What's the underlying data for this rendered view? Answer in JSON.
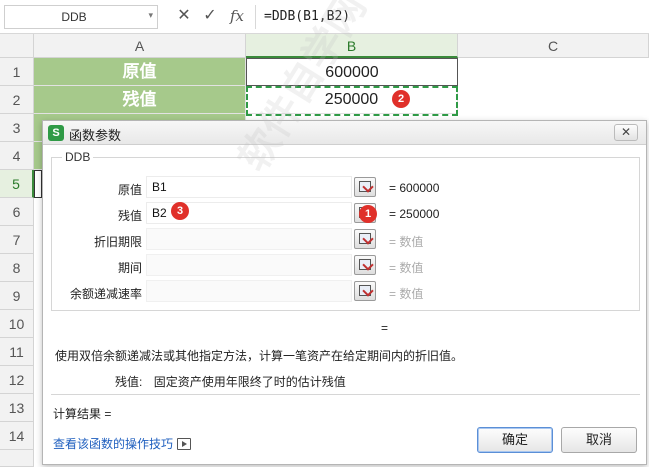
{
  "formula_bar": {
    "name_box": "DDB",
    "cancel_glyph": "✕",
    "enter_glyph": "✓",
    "fx_label": "fx",
    "formula": "=DDB(B1,B2)"
  },
  "sheet": {
    "columns": [
      "A",
      "B",
      "C"
    ],
    "rows": [
      "1",
      "2",
      "3",
      "4",
      "5",
      "6",
      "7",
      "8",
      "9",
      "10",
      "11",
      "12",
      "13",
      "14"
    ],
    "cells": {
      "a1": "原值",
      "b1": "600000",
      "a2": "残值",
      "b2": "250000"
    },
    "badge_cell": "2"
  },
  "dialog": {
    "title": "函数参数",
    "close_glyph": "✕",
    "function_name": "DDB",
    "args": [
      {
        "label": "原值",
        "value": "B1",
        "result": "= 600000"
      },
      {
        "label": "残值",
        "value": "B2",
        "result": "= 250000"
      },
      {
        "label": "折旧期限",
        "value": "",
        "result": "= 数值"
      },
      {
        "label": "期间",
        "value": "",
        "result": "= 数值"
      },
      {
        "label": "余额递减速率",
        "value": "",
        "result": "= 数值"
      }
    ],
    "badge_collapse": "1",
    "badge_input": "3",
    "equals": "=",
    "description": "使用双倍余额递减法或其他指定方法，计算一笔资产在给定期间内的折旧值。",
    "param_name": "残值:",
    "param_desc": "固定资产使用年限终了时的估计残值",
    "result_label": "计算结果  =",
    "help_link": "查看该函数的操作技巧",
    "ok_label": "确定",
    "cancel_label": "取消"
  },
  "colors": {
    "accent_green": "#2f9a46",
    "label_fill": "#a6c98b",
    "badge_red": "#e0302a",
    "link_blue": "#1f5fbf"
  },
  "watermark": "软件自学网 RJZXW.COM"
}
